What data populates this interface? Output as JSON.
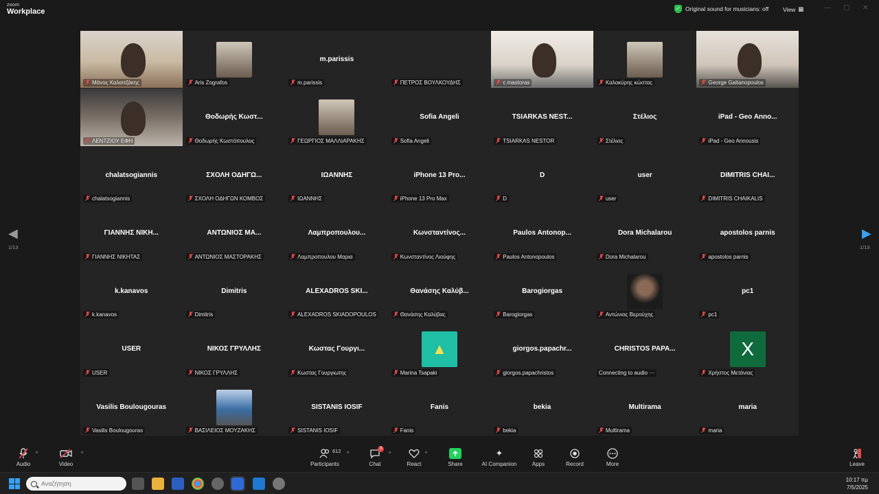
{
  "app": {
    "logo_small": "zoom",
    "logo_big": "Workplace"
  },
  "header": {
    "sound_label": "Original sound for musicians: off",
    "view_label": "View"
  },
  "pager": {
    "left": "1/13",
    "right": "1/13"
  },
  "tiles": [
    {
      "label": "Μάνος Καλαιτζάκης",
      "kind": "video",
      "active": true
    },
    {
      "label": "Aris Zografos",
      "kind": "photo"
    },
    {
      "label": "m.parissis",
      "big": "m.parissis"
    },
    {
      "label": "ΠΕΤΡΟΣ ΒΟΥΛΚΟΥΔΗΣ",
      "big": ""
    },
    {
      "label": "c.mastoras",
      "kind": "video"
    },
    {
      "label": "Καλοκύρης κώστας",
      "kind": "photo"
    },
    {
      "label": "George Gaitanopoulos",
      "kind": "video"
    },
    {
      "label": "ΛΕΝΤΖΙΟΥ ΕΦΗ",
      "kind": "video"
    },
    {
      "label": "Θοδωρής Κωστόπουλος",
      "big": "Θοδωρής Κωστ..."
    },
    {
      "label": "ΓΕΩΡΓΙΟΣ ΜΑΛΛΙΑΡΑΚΗΣ",
      "kind": "photo"
    },
    {
      "label": "Sofia Angeli",
      "big": "Sofia Angeli"
    },
    {
      "label": "TSIARKAS NESTOR",
      "big": "TSIARKAS NEST..."
    },
    {
      "label": "Στέλιος",
      "big": "Στέλιος"
    },
    {
      "label": "iPad - Geo Annousis",
      "big": "iPad - Geo Anno..."
    },
    {
      "label": "chalatsogiannis",
      "big": "chalatsogiannis"
    },
    {
      "label": "ΣΧΟΛΗ ΟΔΗΓΩΝ ΚΟΜΒΟΣ",
      "big": "ΣΧΟΛΗ ΟΔΗΓΩ..."
    },
    {
      "label": "ΙΩΑΝΝΗΣ",
      "big": "ΙΩΑΝΝΗΣ"
    },
    {
      "label": "iPhone 13 Pro Max",
      "big": "iPhone 13 Pro..."
    },
    {
      "label": "D",
      "big": "D"
    },
    {
      "label": "user",
      "big": "user"
    },
    {
      "label": "DIMITRIS CHAIKALIS",
      "big": "DIMITRIS CHAI..."
    },
    {
      "label": "ΓΙΑΝΝΗΣ ΝΙΚΗΤΑΣ",
      "big": "ΓΙΑΝΝΗΣ ΝΙΚΗ..."
    },
    {
      "label": "ΑΝΤΩΝΙΟΣ ΜΑΣΤΟΡΑΚΗΣ",
      "big": "ΑΝΤΩΝΙΟΣ ΜΑ..."
    },
    {
      "label": "Λαμπροπουλου Μαρια",
      "big": "Λαμπροπουλου..."
    },
    {
      "label": "Κωνσταντίνος Λιούφης",
      "big": "Κωνσταντίνος..."
    },
    {
      "label": "Paulos Antonopoulos",
      "big": "Paulos Antonop..."
    },
    {
      "label": "Dora Michalarou",
      "big": "Dora Michalarou"
    },
    {
      "label": "apostolos parnis",
      "big": "apostolos parnis"
    },
    {
      "label": "k.kanavos",
      "big": "k.kanavos"
    },
    {
      "label": "Dimitris",
      "big": "Dimitris"
    },
    {
      "label": "ALEXADROS SKIADOPOULOS",
      "big": "ALEXADROS SKI..."
    },
    {
      "label": "Θανάσης Καλύβας",
      "big": "Θανάσης Καλύβ..."
    },
    {
      "label": "Barogiorgas",
      "big": "Barogiorgas"
    },
    {
      "label": "Αντώνιος Βερούχης",
      "kind": "photo-dark"
    },
    {
      "label": "pc1",
      "big": "pc1"
    },
    {
      "label": "USER",
      "big": "USER"
    },
    {
      "label": "ΝΙΚΟΣ ΓΡΥΛΛΗΣ",
      "big": "ΝΙΚΟΣ ΓΡΥΛΛΗΣ"
    },
    {
      "label": "Κωστας Γουργιωτης",
      "big": "Κωστας Γουργι..."
    },
    {
      "label": "Marina Tsapaki",
      "kind": "logo"
    },
    {
      "label": "giorgos.papachristos",
      "big": "giorgos.papachr..."
    },
    {
      "label": "Connecting to audio ···",
      "big": "CHRISTOS PAPA...",
      "nomute": true
    },
    {
      "label": "Χρήστος Μετάνιας",
      "kind": "letter",
      "letter": "X"
    },
    {
      "label": "Vasilis Boulougouras",
      "big": "Vasilis Boulougouras"
    },
    {
      "label": "ΒΑΣΙΛΕΙΟΣ ΜΟΥΖΑΚΗΣ",
      "kind": "truck"
    },
    {
      "label": "SISTANIS IOSIF",
      "big": "SISTANIS IOSIF"
    },
    {
      "label": "Fanis",
      "big": "Fanis"
    },
    {
      "label": "bekia",
      "big": "bekia"
    },
    {
      "label": "Multirama",
      "big": "Multirama"
    },
    {
      "label": "maria",
      "big": "maria"
    }
  ],
  "toolbar": {
    "audio": "Audio",
    "video": "Video",
    "participants": "Participants",
    "participants_count": "612",
    "chat": "Chat",
    "chat_badge": "3",
    "react": "React",
    "share": "Share",
    "ai": "AI Companion",
    "apps": "Apps",
    "record": "Record",
    "more": "More",
    "leave": "Leave"
  },
  "taskbar": {
    "search_placeholder": "Αναζήτηση",
    "time": "10:17 πμ",
    "date": "7/5/2025"
  },
  "colors": {
    "active_border": "#23d160",
    "mute": "#e04848",
    "share": "#23d160"
  }
}
